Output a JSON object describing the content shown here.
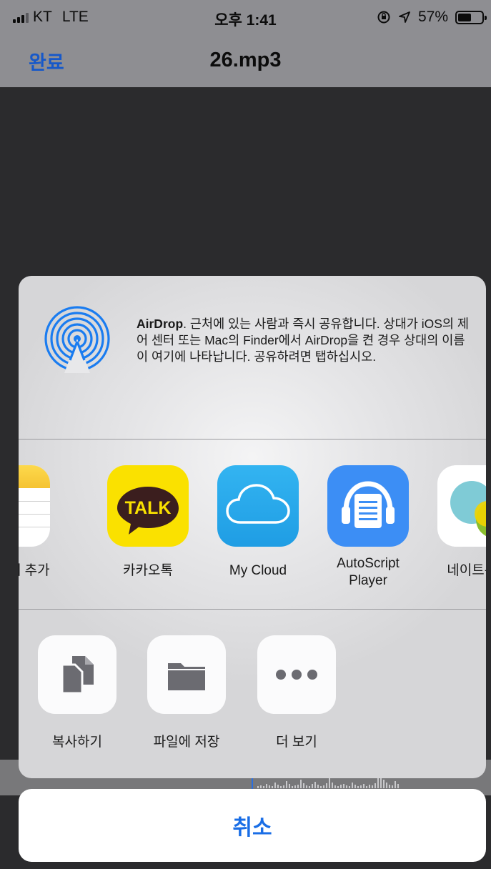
{
  "status_bar": {
    "carrier": "KT",
    "network": "LTE",
    "time": "오후 1:41",
    "battery_percent": "57%",
    "battery_level": 0.57,
    "icons": [
      "signal-icon",
      "orientation-lock-icon",
      "location-icon",
      "battery-icon"
    ]
  },
  "nav": {
    "done_label": "완료",
    "title": "26.mp3"
  },
  "airdrop": {
    "title": "AirDrop",
    "description": ". 근처에 있는 사람과 즉시 공유합니다. 상대가 iOS의 제어 센터 또는 Mac의 Finder에서 AirDrop을 켠 경우 상대의 이름이 여기에 나타납니다. 공유하려면 탭하십시오.",
    "icon": "airdrop-icon",
    "accent_color": "#1a7cf0"
  },
  "apps": [
    {
      "label": "모에 추가",
      "icon": "notes-icon"
    },
    {
      "label": "카카오톡",
      "icon": "kakaotalk-icon",
      "icon_text": "TALK"
    },
    {
      "label": "My Cloud",
      "icon": "cloud-icon"
    },
    {
      "label_line1": "AutoScript",
      "label_line2": "Player",
      "icon": "autoscript-player-icon"
    },
    {
      "label": "네이트온이",
      "icon": "nateon-icon"
    }
  ],
  "actions": [
    {
      "label": "복사하기",
      "icon": "copy-icon"
    },
    {
      "label": "파일에 저장",
      "icon": "folder-icon"
    },
    {
      "label": "더 보기",
      "icon": "more-icon"
    }
  ],
  "cancel_label": "취소",
  "colors": {
    "ios_blue": "#1a6ee6",
    "kakao_yellow": "#fae100",
    "cloud_blue": "#29aaeb",
    "autoscript_blue": "#3c8ef5"
  }
}
